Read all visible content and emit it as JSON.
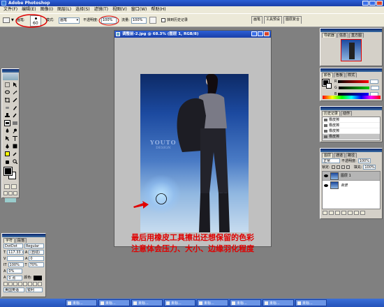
{
  "app": {
    "title": "Adobe Photoshop"
  },
  "menu": [
    "文件(F)",
    "编辑(E)",
    "图像(I)",
    "图层(L)",
    "选择(S)",
    "滤镜(T)",
    "视图(V)",
    "窗口(W)",
    "帮助(H)"
  ],
  "options": {
    "brush_label": "画笔:",
    "brush_size": "60",
    "mode_label": "模式:",
    "mode_value": "画笔",
    "opacity_label": "不透明度:",
    "opacity_value": "100%",
    "flow_label": "流量:",
    "flow_value": "100%",
    "history_check": "抹到历史记录"
  },
  "dock_tabs": [
    "画笔",
    "工具预设",
    "图层复合"
  ],
  "document": {
    "title": "调整前-2.jpg @ 68.3% (图层 1, RGB/8)",
    "watermark_1": "YOUTO",
    "watermark_2": "DESIGN",
    "caption_line1": "最后用橡皮工具擦出还想保留的色彩",
    "caption_line2": "注意体会压力、大小、边缘羽化程度"
  },
  "navigator": {
    "tabs": [
      "导航器",
      "信息",
      "直方图"
    ]
  },
  "color_panel": {
    "tabs": [
      "颜色",
      "色板",
      "样式"
    ],
    "channels": [
      "R",
      "G",
      "B"
    ],
    "values": [
      "",
      "",
      ""
    ]
  },
  "history": {
    "tabs": [
      "历史记录",
      "动作"
    ],
    "items": [
      "橡皮擦",
      "橡皮擦",
      "橡皮擦",
      "橡皮擦"
    ]
  },
  "layers": {
    "tabs": [
      "图层",
      "通道",
      "路径"
    ],
    "blend_mode": "正常",
    "opacity_label": "不透明度:",
    "opacity_value": "100%",
    "lock_label": "锁定:",
    "fill_label": "填充:",
    "fill_value": "100%",
    "items": [
      {
        "name": "图层 1",
        "selected": true
      },
      {
        "name": "背景",
        "selected": false
      }
    ]
  },
  "char_panel": {
    "tabs": [
      "字符",
      "段落"
    ],
    "font": "DotDot",
    "style": "Regular",
    "size": "117.33 点",
    "leading": "(自动)",
    "kerning": "",
    "tracking": "0",
    "vscale": "100%",
    "hscale": "70%",
    "baseline": "0%",
    "shift": "0 点",
    "color_label": "颜色:",
    "language": "美国英语",
    "antialias": "锐利"
  },
  "taskbar": [
    "未标...",
    "未标...",
    "未标...",
    "未标...",
    "未标...",
    "未标...",
    "未标...",
    "未标..."
  ],
  "colors": {
    "accent": "#1a3fa8",
    "caption": "#e00000",
    "annotation": "#e00000"
  }
}
